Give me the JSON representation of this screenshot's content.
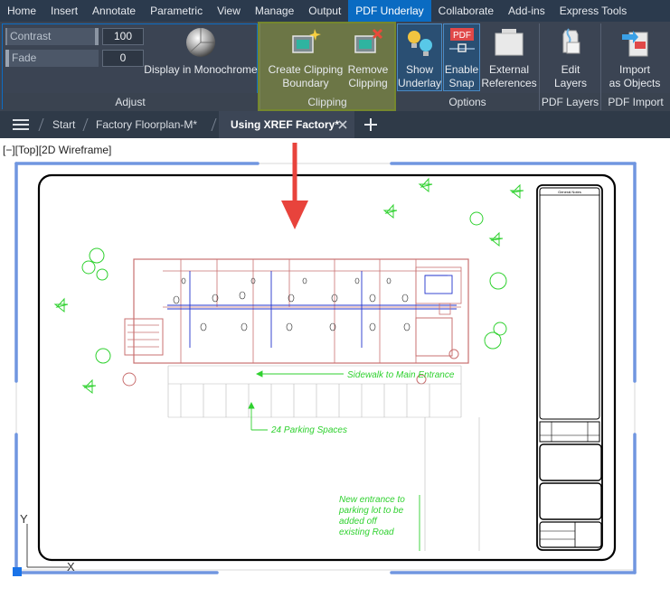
{
  "ribbon_tabs": [
    {
      "label": "Home"
    },
    {
      "label": "Insert"
    },
    {
      "label": "Annotate"
    },
    {
      "label": "Parametric"
    },
    {
      "label": "View"
    },
    {
      "label": "Manage"
    },
    {
      "label": "Output"
    },
    {
      "label": "PDF Underlay",
      "active": true
    },
    {
      "label": "Collaborate"
    },
    {
      "label": "Add-ins"
    },
    {
      "label": "Express Tools"
    }
  ],
  "adjust": {
    "contrast_label": "Contrast",
    "contrast_value": "100",
    "fade_label": "Fade",
    "fade_value": "0",
    "monochrome_label": "Display in Monochrome",
    "panel_label": "Adjust"
  },
  "clipping": {
    "create_line1": "Create Clipping",
    "create_line2": "Boundary",
    "remove_line1": "Remove",
    "remove_line2": "Clipping",
    "panel_label": "Clipping"
  },
  "options": {
    "show_line1": "Show",
    "show_line2": "Underlay",
    "snap_line1": "Enable",
    "snap_line2": "Snap",
    "snap_badge": "PDF",
    "ext_line1": "External",
    "ext_line2": "References",
    "panel_label": "Options"
  },
  "pdf_layers": {
    "edit_line1": "Edit",
    "edit_line2": "Layers",
    "panel_label": "PDF Layers"
  },
  "pdf_import": {
    "import_line1": "Import",
    "import_line2": "as Objects",
    "panel_label": "PDF Import"
  },
  "file_tabs": {
    "start": "Start",
    "tab1": "Factory Floorplan-M*",
    "tab2": "Using XREF Factory*"
  },
  "viewport": {
    "label": "[−][Top][2D Wireframe]"
  },
  "drawing": {
    "sidewalk_note": "Sidewalk to Main Entrance",
    "parking_note": "24 Parking Spaces",
    "entrance_note": [
      "New entrance to",
      "parking lot to be",
      "added off",
      "existing Road"
    ],
    "titleblock_header": "General Notes",
    "ucs_y": "Y",
    "ucs_x": "X"
  },
  "colors": {
    "accent": "#0a6bc2",
    "arrow": "#e8433c",
    "plan_green": "#2fd12f",
    "plan_red": "#c97070",
    "plan_blue": "#2233cc"
  }
}
